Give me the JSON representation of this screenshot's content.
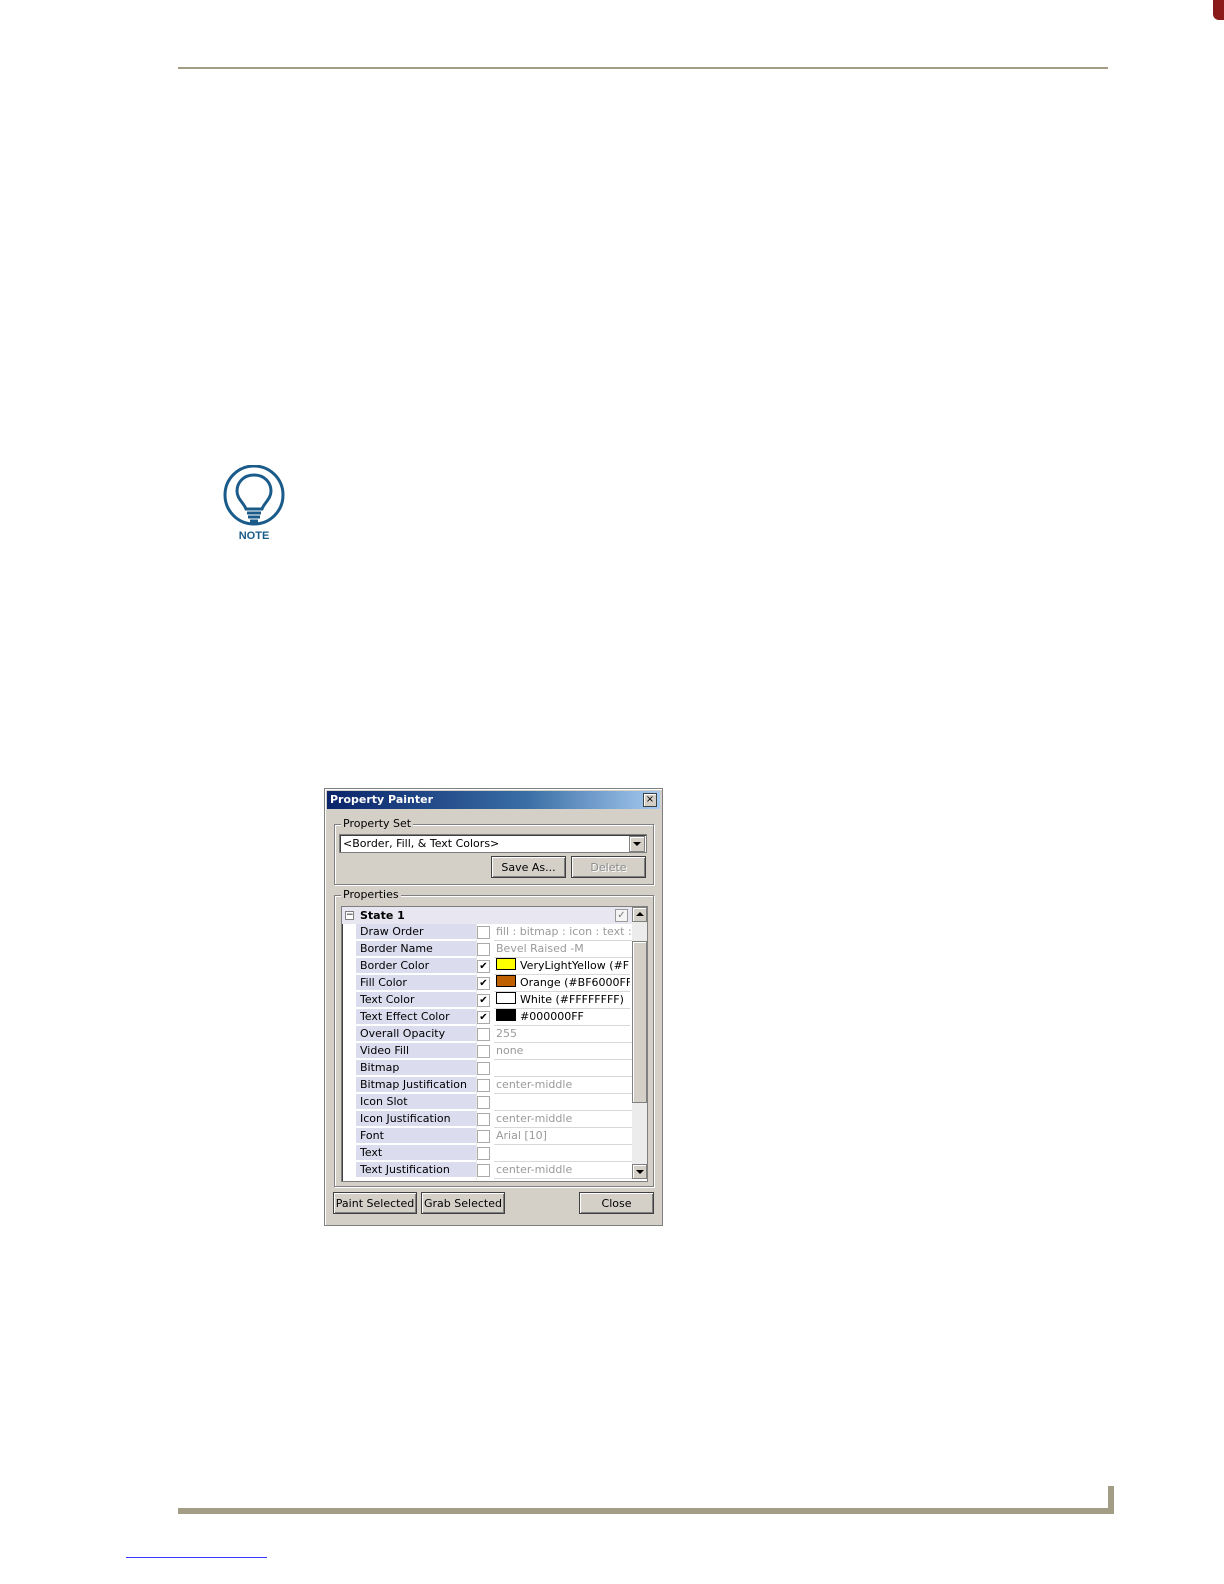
{
  "note": {
    "label": "NOTE"
  },
  "dialog": {
    "title": "Property Painter",
    "close_glyph": "×",
    "property_set": {
      "group_label": "Property Set",
      "selected": "<Border, Fill, & Text Colors>",
      "save_as_label": "Save As...",
      "delete_label": "Delete"
    },
    "properties": {
      "group_label": "Properties",
      "state": {
        "label": "State 1",
        "expander": "−",
        "checked": true
      },
      "rows": [
        {
          "name": "Draw Order",
          "checked": false,
          "value": "fill : bitmap : icon : text : bo...",
          "swatch": null
        },
        {
          "name": "Border Name",
          "checked": false,
          "value": "Bevel Raised -M",
          "swatch": null
        },
        {
          "name": "Border Color",
          "checked": true,
          "value": "VeryLightYellow (#FF...",
          "swatch": "#FFFF00"
        },
        {
          "name": "Fill Color",
          "checked": true,
          "value": "Orange (#BF6000FF)",
          "swatch": "#BF6000"
        },
        {
          "name": "Text Color",
          "checked": true,
          "value": "White (#FFFFFFFF)",
          "swatch": "#FFFFFF"
        },
        {
          "name": "Text Effect Color",
          "checked": true,
          "value": "#000000FF",
          "swatch": "#000000"
        },
        {
          "name": "Overall Opacity",
          "checked": false,
          "value": "255",
          "swatch": null
        },
        {
          "name": "Video Fill",
          "checked": false,
          "value": "none",
          "swatch": null
        },
        {
          "name": "Bitmap",
          "checked": false,
          "value": "",
          "swatch": null
        },
        {
          "name": "Bitmap Justification",
          "checked": false,
          "value": "center-middle",
          "swatch": null
        },
        {
          "name": "Icon Slot",
          "checked": false,
          "value": "",
          "swatch": null
        },
        {
          "name": "Icon Justification",
          "checked": false,
          "value": "center-middle",
          "swatch": null
        },
        {
          "name": "Font",
          "checked": false,
          "value": "Arial [10]",
          "swatch": null
        },
        {
          "name": "Text",
          "checked": false,
          "value": "",
          "swatch": null
        },
        {
          "name": "Text Justification",
          "checked": false,
          "value": "center-middle",
          "swatch": null
        }
      ]
    },
    "buttons": {
      "paint_selected": "Paint Selected",
      "grab_selected": "Grab Selected",
      "close": "Close"
    }
  },
  "colors": {
    "rule": "#a39d86",
    "title_bar": "#0a246a",
    "note_icon": "#1a5b8a"
  }
}
